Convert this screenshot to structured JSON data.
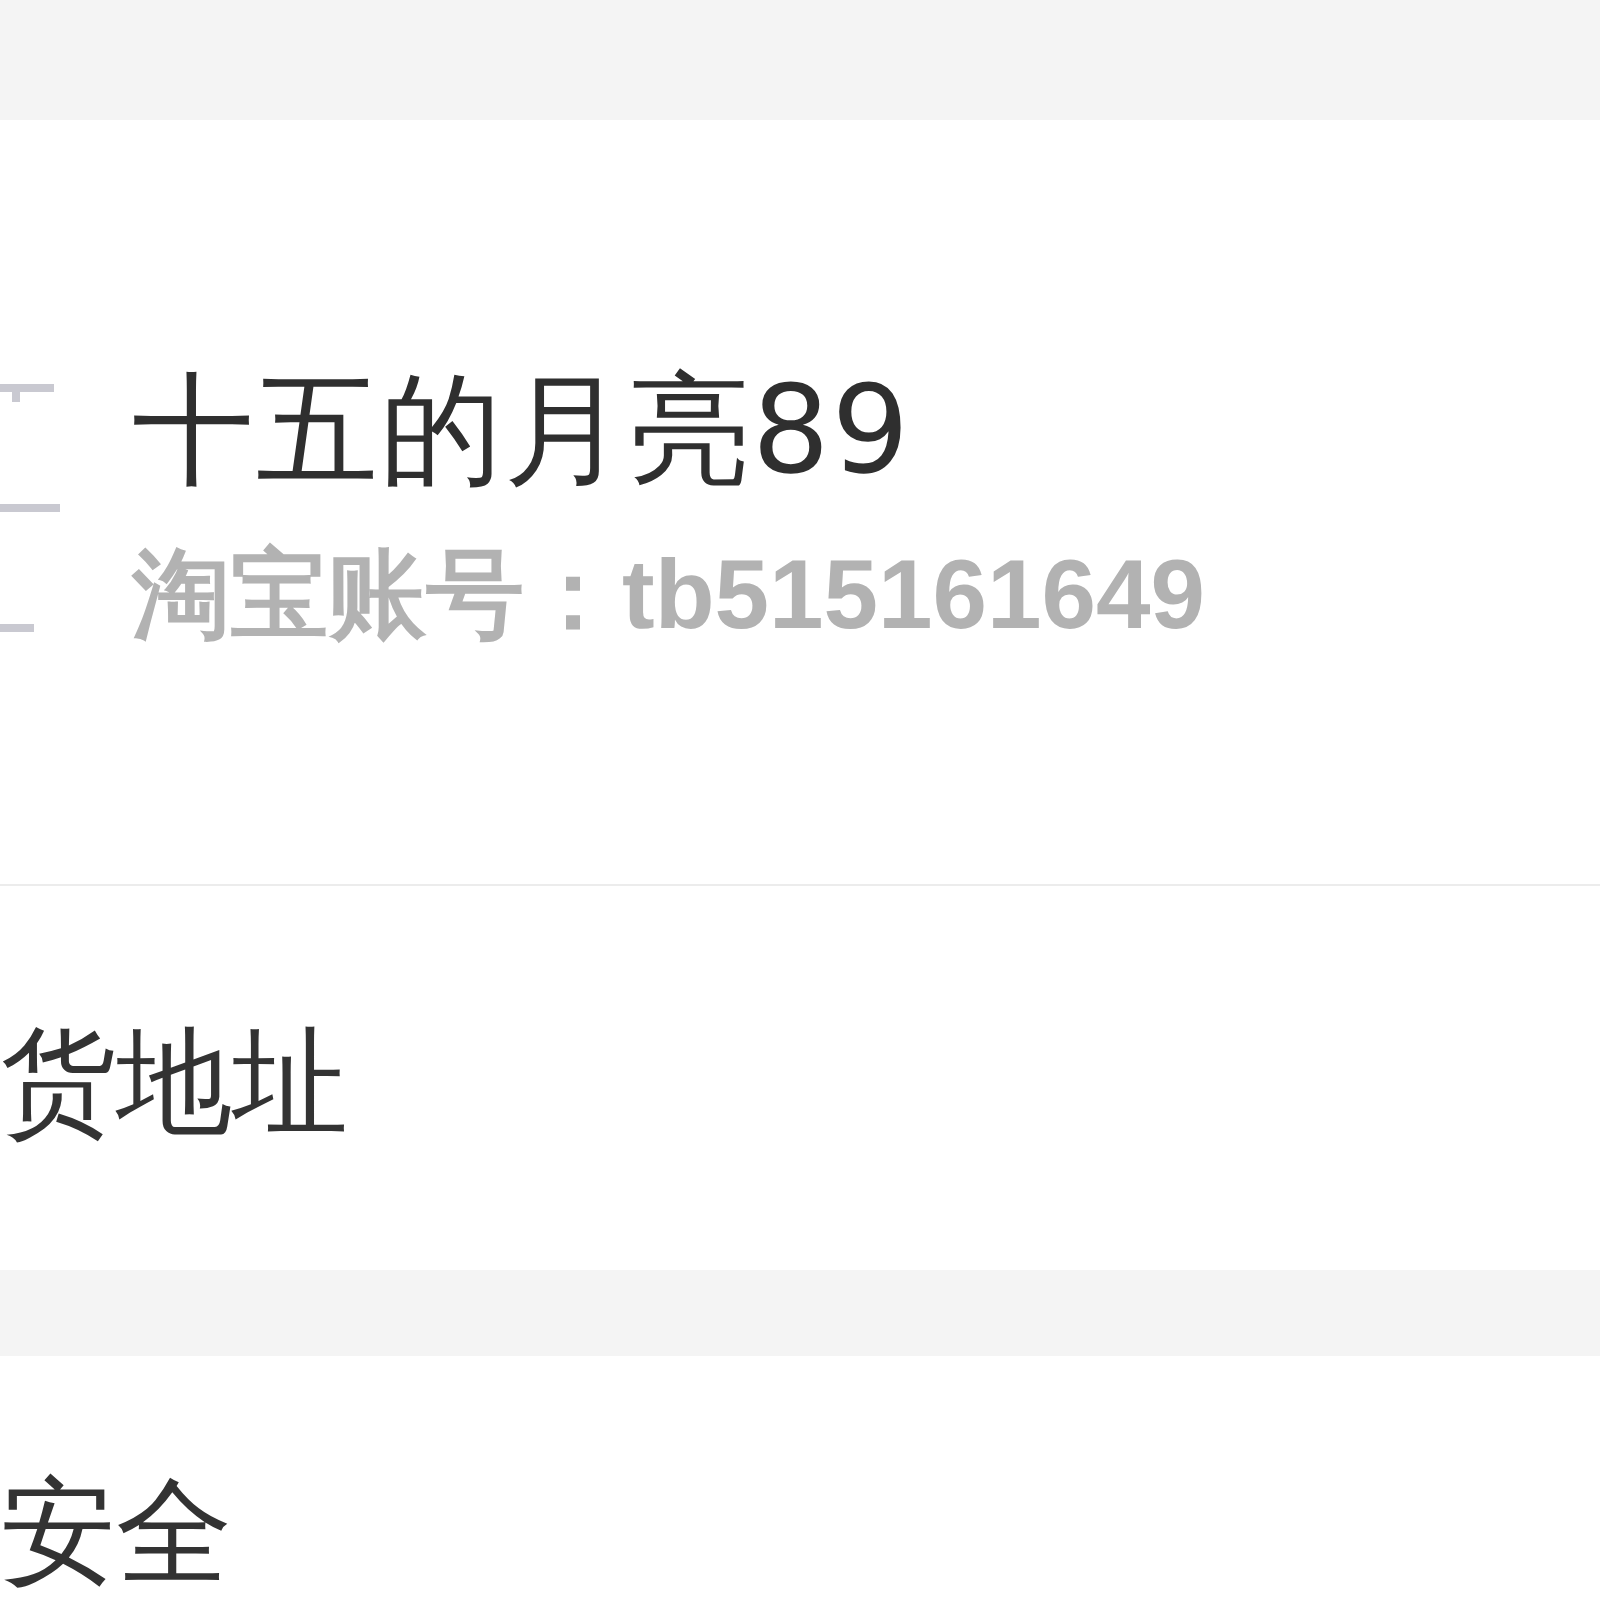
{
  "profile": {
    "name": "十五的月亮89",
    "account": "淘宝账号：tb515161649"
  },
  "sections": [
    {
      "items": [
        {
          "label": "货地址"
        }
      ]
    },
    {
      "items": [
        {
          "label": "安全"
        }
      ]
    }
  ]
}
